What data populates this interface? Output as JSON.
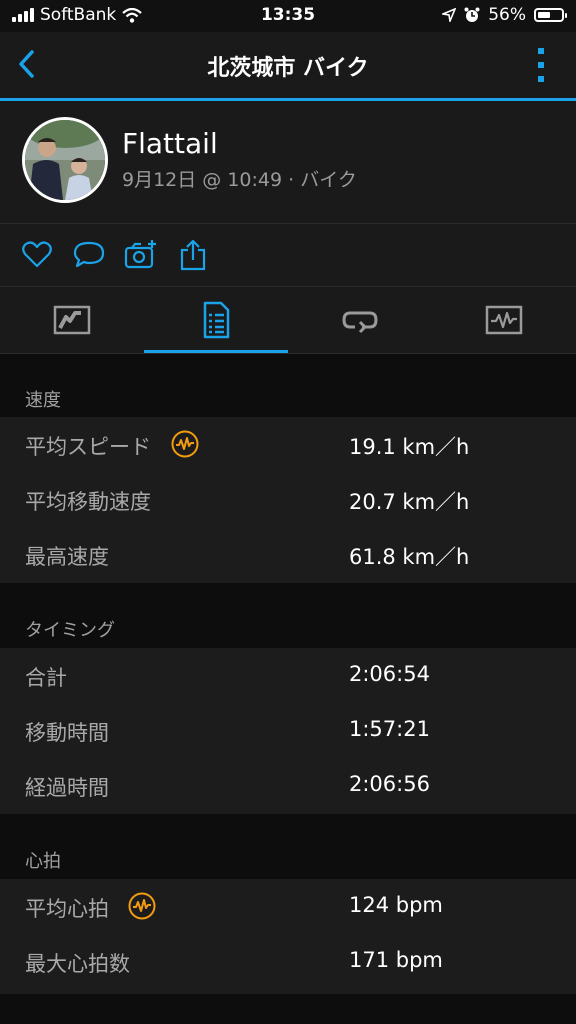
{
  "status_bar": {
    "carrier": "SoftBank",
    "time": "13:35",
    "battery_percent": "56%",
    "battery_level": 0.56
  },
  "nav": {
    "title": "北茨城市 バイク",
    "back_icon": "chevron-left-icon",
    "more_icon": "vertical-dots-icon"
  },
  "profile": {
    "name": "Flattail",
    "subtitle": "9月12日 @ 10:49 · バイク"
  },
  "actions": [
    "heart-icon",
    "comment-icon",
    "camera-add-icon",
    "share-icon"
  ],
  "tabs": [
    "overview-map-icon",
    "stats-sheet-icon",
    "laps-icon",
    "charts-icon"
  ],
  "selected_tab": 1,
  "sections": [
    {
      "header": "速度",
      "rows": [
        {
          "label": "平均スピード",
          "value": "19.1 km／h",
          "badge": true
        },
        {
          "label": "平均移動速度",
          "value": "20.7 km／h"
        },
        {
          "label": "最高速度",
          "value": "61.8 km／h"
        }
      ]
    },
    {
      "header": "タイミング",
      "rows": [
        {
          "label": "合計",
          "value": "2:06:54"
        },
        {
          "label": "移動時間",
          "value": "1:57:21"
        },
        {
          "label": "経過時間",
          "value": "2:06:56"
        }
      ]
    },
    {
      "header": "心拍",
      "rows": [
        {
          "label": "平均心拍",
          "value": "124 bpm",
          "badge": true
        },
        {
          "label": "最大心拍数",
          "value": "171 bpm"
        }
      ]
    }
  ],
  "colors": {
    "accent": "#1aa3e8",
    "badge": "#f39c12",
    "background": "#0d0d0d",
    "panel": "#1c1c1c"
  }
}
